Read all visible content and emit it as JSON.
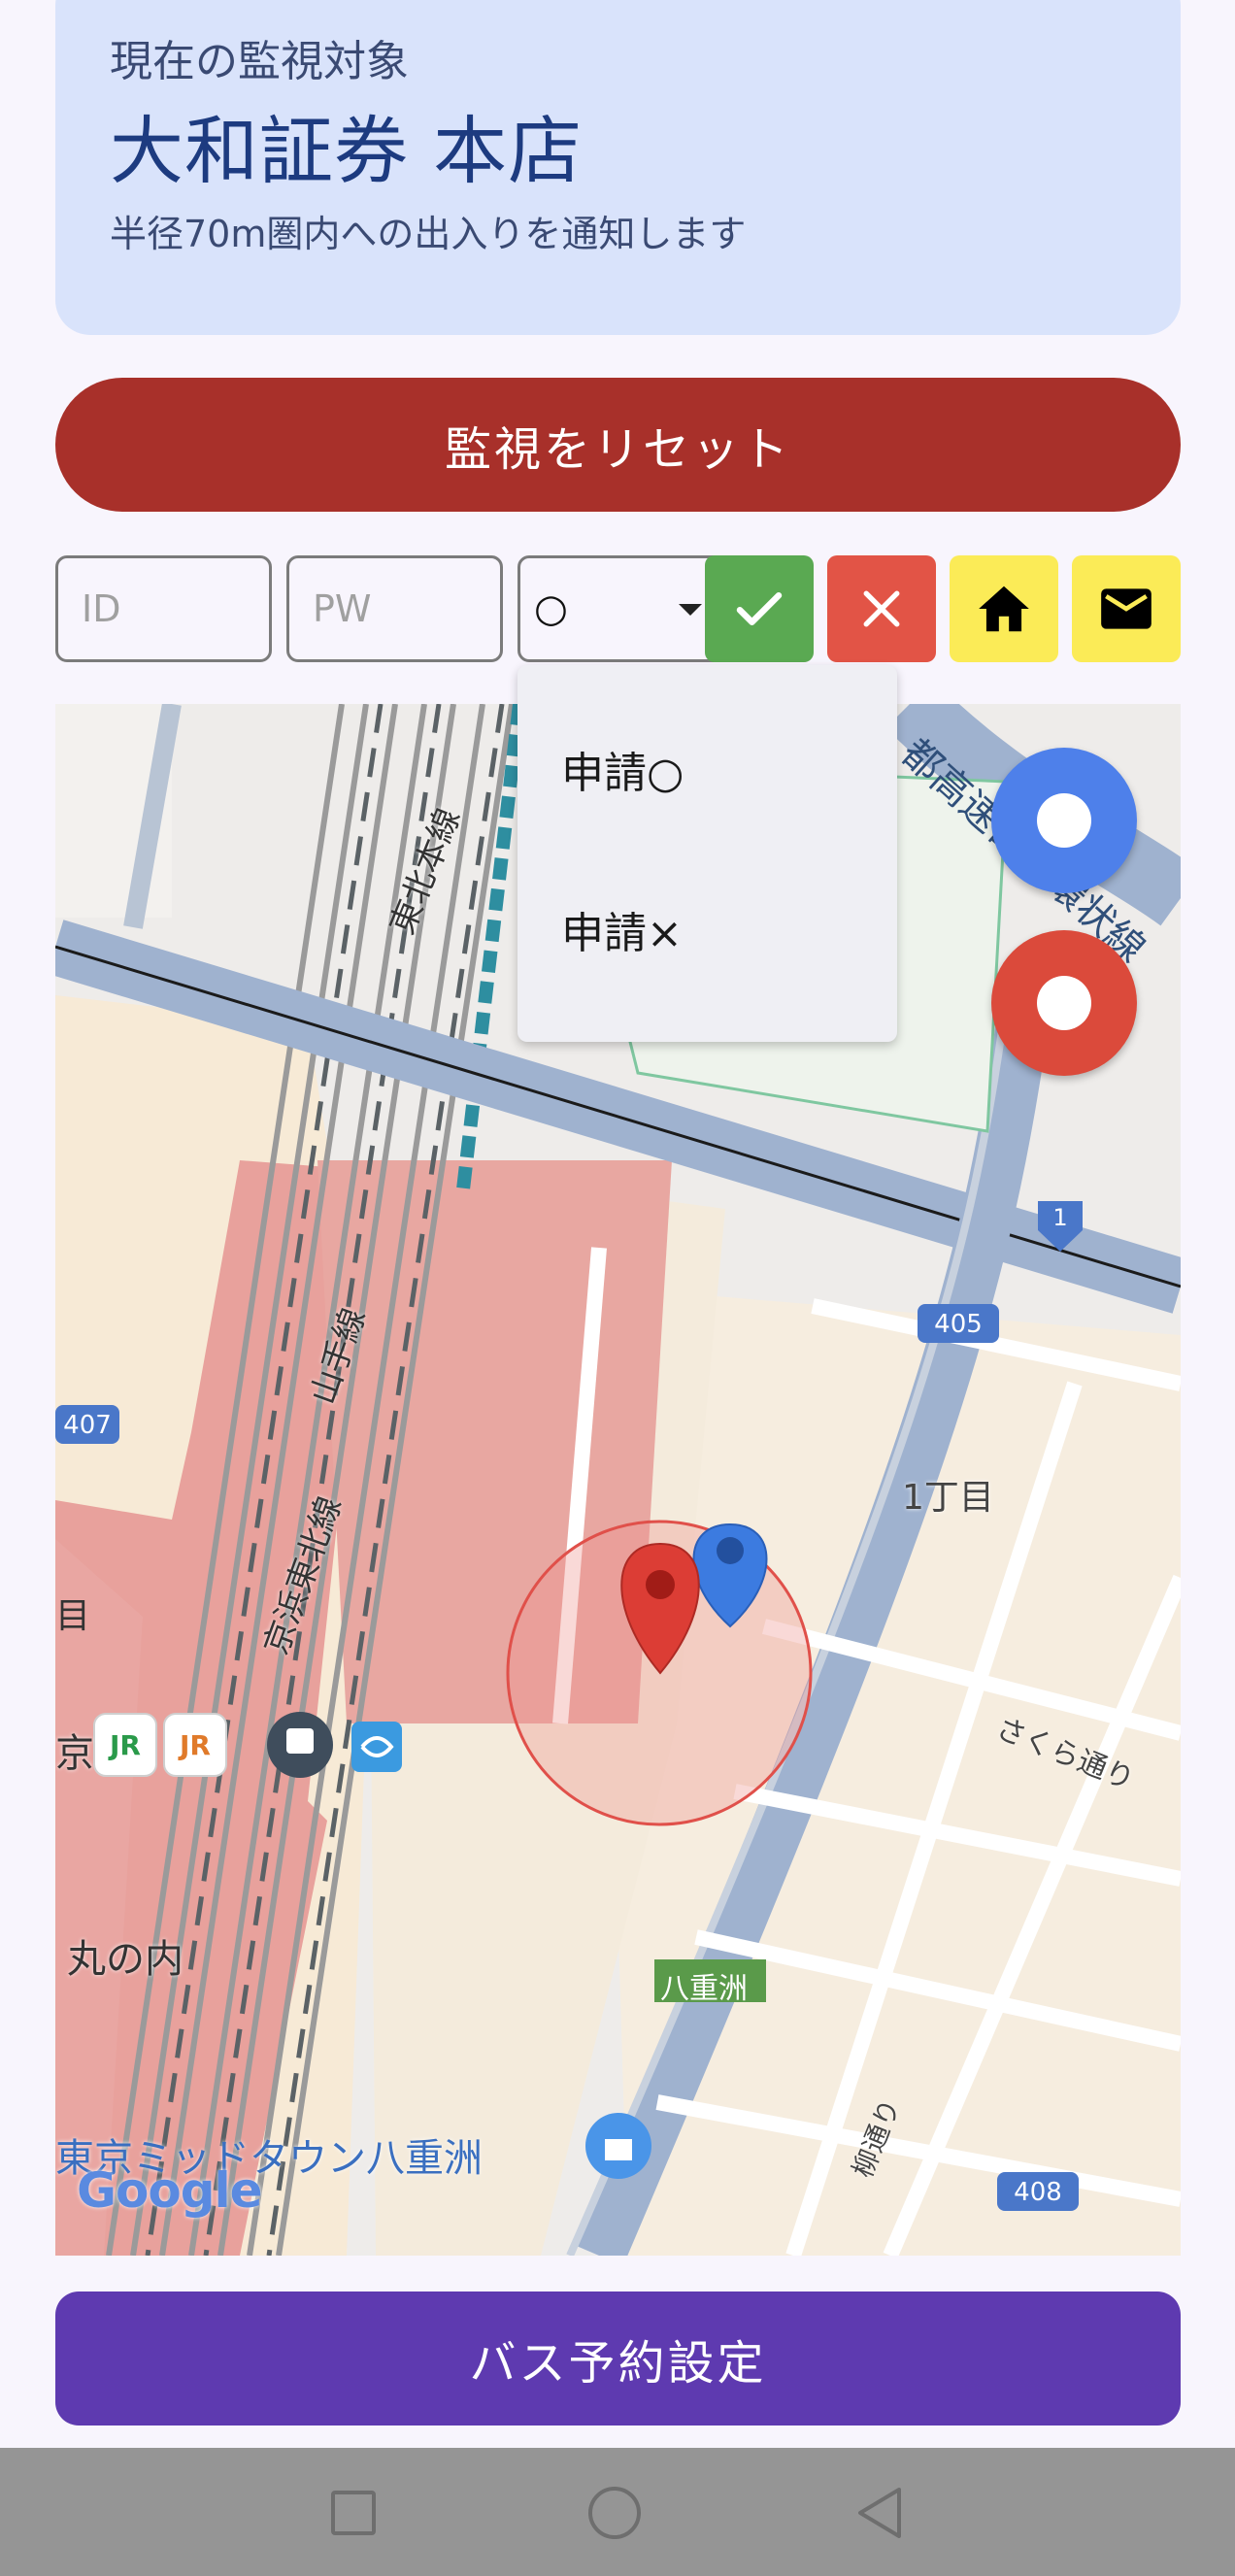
{
  "monitor": {
    "caption": "現在の監視対象",
    "title": "大和証券 本店",
    "description": "半径70m圏内への出入りを通知します"
  },
  "actions": {
    "reset_label": "監視をリセット",
    "bus_label": "バス予約設定"
  },
  "form": {
    "id_placeholder": "ID",
    "pw_placeholder": "PW",
    "select_value": "○",
    "options": [
      "申請○",
      "申請×"
    ]
  },
  "icons": {
    "ok": "check-icon",
    "ng": "close-icon",
    "home": "home-icon",
    "mail": "mail-icon"
  },
  "map": {
    "labels": {
      "tohoku_line": "東北本線",
      "yamanote": "山手線",
      "keihin": "京浜東北線",
      "itchome": "1丁目",
      "sakura": "さくら通り",
      "marunouchi": "丸の内",
      "yaesu": "八重洲",
      "midtown": "東京ミッドタウン八重洲",
      "yanagi": "柳通り",
      "highway": "都高速都心環状線",
      "kyo": "京",
      "me": "目",
      "r1": "1",
      "r405": "405",
      "r407": "407",
      "r408": "408",
      "jr": "JR",
      "google": "Google"
    }
  },
  "colors": {
    "card_bg": "#d9e3fb",
    "reset_red": "#a8302a",
    "ok_green": "#5aa952",
    "ng_red": "#e25446",
    "yellow": "#fbeb57",
    "fab_blue": "#4e80ea",
    "fab_red": "#db4a3b",
    "bus_purple": "#5e3ab0"
  }
}
